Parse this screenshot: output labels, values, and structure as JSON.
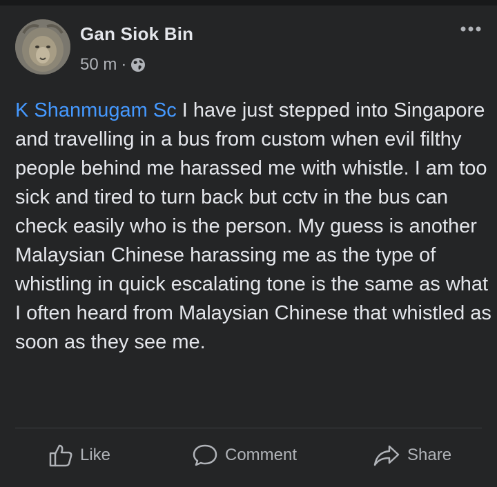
{
  "post": {
    "author": "Gan Siok Bin",
    "time": "50 m",
    "separator": "·",
    "privacy_icon": "globe-icon",
    "more_icon": "more-options-icon",
    "mention": "K Shanmugam Sc",
    "body": " I have just stepped into Singapore and travelling in a bus from custom when evil filthy people behind me harassed me with whistle. I am too sick and tired to turn back but cctv in the bus can check easily who is the person. My guess is another Malaysian Chinese harassing me as the type of whistling in quick escalating tone is the same as what I often heard from Malaysian Chinese that whistled as soon as they see me."
  },
  "actions": {
    "like_label": "Like",
    "comment_label": "Comment",
    "share_label": "Share"
  },
  "colors": {
    "background": "#242526",
    "text": "#e4e6eb",
    "secondary_text": "#b0b3b8",
    "mention": "#4599ff"
  }
}
